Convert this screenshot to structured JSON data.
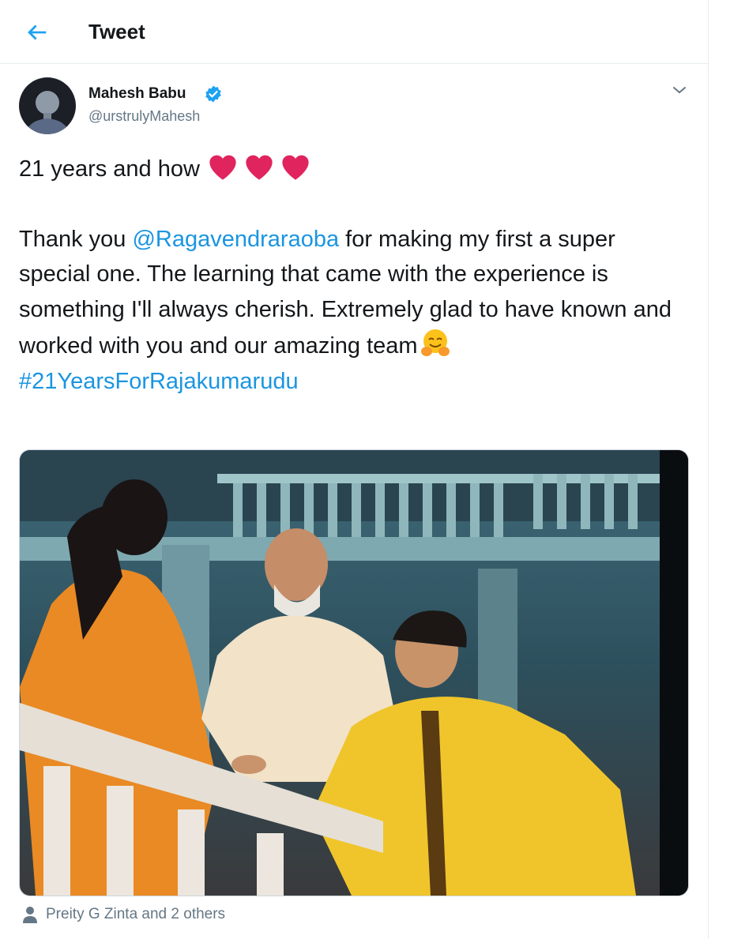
{
  "header": {
    "back_icon": "arrow-left-icon",
    "title": "Tweet"
  },
  "author": {
    "name": "Mahesh Babu",
    "handle": "@urstrulyMahesh",
    "verified_icon": "verified-badge-icon",
    "menu_icon": "chevron-down-icon"
  },
  "tweet": {
    "line1_text": "21 years and how",
    "line1_emoji": [
      "red-heart-icon",
      "red-heart-icon",
      "red-heart-icon"
    ],
    "body_prefix": "Thank you ",
    "mention": "@Ragavendraraoba",
    "body_rest": " for making my first a super special one. The learning that came with the experience is something I'll always cherish. Extremely glad to have known and worked with you and our amazing team",
    "body_emoji": "hugging-face-icon",
    "hashtag": "#21YearsForRajakumarudu"
  },
  "media": {
    "type": "photo",
    "description_icon": "tweet-photo"
  },
  "likes": {
    "icon": "person-icon",
    "text": "Preity G Zinta and 2 others"
  },
  "colors": {
    "link": "#1b95e0",
    "secondary_text": "#657786",
    "divider": "#e6ecf0",
    "heart": "#e0245e"
  }
}
